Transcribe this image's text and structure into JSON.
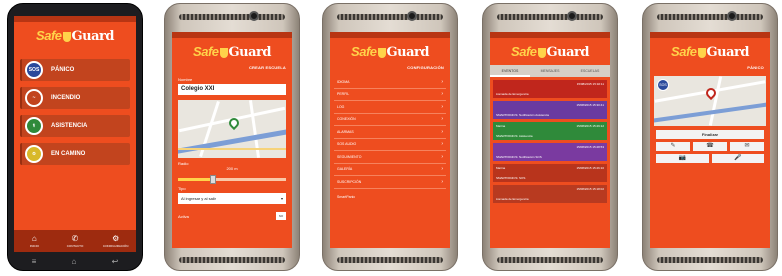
{
  "logo": {
    "safe": "Safe",
    "guard": "Guard"
  },
  "phone1": {
    "buttons": [
      {
        "icon": "SOS",
        "label": "PÁNICO",
        "color": "#2a4a9c"
      },
      {
        "icon": "~",
        "label": "INCENDIO",
        "color": "#c2441e"
      },
      {
        "icon": "⚕",
        "label": "ASISTENCIA",
        "color": "#2f8a3a"
      },
      {
        "icon": "⦸",
        "label": "EN CAMINO",
        "color": "#d8b92a"
      }
    ],
    "tabs": [
      {
        "icon": "⌂",
        "label": "INICIO"
      },
      {
        "icon": "✆",
        "label": "CONTACTO"
      },
      {
        "icon": "⚙",
        "label": "CONFIGURACIÓN"
      }
    ],
    "nav": [
      "≡",
      "⌂",
      "↩"
    ]
  },
  "phone2": {
    "header_link": "CREAR ESCUELA",
    "name_label": "Nombre",
    "name_value": "Colegio XXI",
    "radius_label": "Radio",
    "radius_value": "200 m",
    "radius_fraction": 0.32,
    "type_label": "Tipo",
    "type_value": "Al ingresar y al salir",
    "active_label": "Activa",
    "active_button": "NO"
  },
  "phone3": {
    "header_link": "CONFIGURACIÓN",
    "items": [
      "IDIOMA",
      "PERFIL",
      "LOG",
      "CONEXIÓN",
      "ALARMAS",
      "SOS AUDIO",
      "SEGUIMIENTO",
      "GALERÍA",
      "SUSCRIPCIÓN"
    ],
    "footer": "SmartPanic"
  },
  "phone4": {
    "tabs": [
      "EVENTOS",
      "MENSAJES",
      "ESCUELAS"
    ],
    "cards": [
      {
        "title": "Llamada de Emergencia",
        "date": "15/08/2015 15:32:11",
        "color": "#c0261c"
      },
      {
        "title": "SMARTPANICS: Notificación Asistencia",
        "date": "15/08/2015 15:30:41",
        "color": "#6a3aa0"
      },
      {
        "title": "Marina",
        "sub": "SMARTPANICS: Asistencia",
        "date": "15/08/2015 15:29:12",
        "color": "#2f8a3a"
      },
      {
        "title": "SMARTPANICS: Notificación SOS",
        "date": "15/08/2015 15:28:53",
        "color": "#7a3aa0"
      },
      {
        "title": "Marina",
        "sub": "SMARTPANICS: SOS",
        "date": "15/08/2015 15:26:10",
        "color": "#b8341c"
      },
      {
        "title": "Llamada de Emergencia",
        "date": "15/08/2015 15:18:02",
        "color": "#b83a20"
      }
    ]
  },
  "phone5": {
    "header_link": "PÁNICO",
    "sos_badge": "SOS",
    "primary_button": "Finalizar",
    "row1": [
      "✎",
      "☎",
      "✉"
    ],
    "row2": [
      "📷",
      "🎤"
    ]
  }
}
